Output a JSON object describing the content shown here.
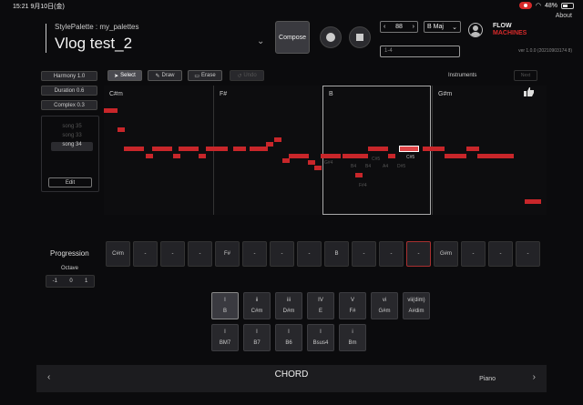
{
  "status_bar": {
    "time": "15:21",
    "date": "9月10日(金)",
    "battery": "48%"
  },
  "header": {
    "palette_label": "StylePalette : my_palettes",
    "song_title": "Vlog test_2",
    "compose_label": "Compose",
    "tempo": "88",
    "key": "B Maj",
    "range": "1-4",
    "logo_line1": "FLOW",
    "logo_line2": "MACHINES",
    "about": "About",
    "version": "ver 1.0.0 (20210903174 8)"
  },
  "params": {
    "harmony": "Harmony 1.0",
    "duration": "Duration 0.6",
    "complex": "Complex 0.3"
  },
  "songs": [
    "song 35",
    "song 33",
    "song 34"
  ],
  "edit_label": "Edit",
  "toolbar": {
    "select": "Select",
    "draw": "Draw",
    "erase": "Erase",
    "undo": "Undo",
    "instruments": "Instruments",
    "next": "Next"
  },
  "piano_roll": {
    "sections": [
      "C#m",
      "F#",
      "B",
      "G#m"
    ],
    "ghost_notes": [
      "C#5",
      "G#4",
      "B4",
      "B4",
      "A4",
      "D#5",
      "F#4",
      "C#5"
    ],
    "selected_note_label": "C#5"
  },
  "progression": {
    "label": "Progression",
    "octave_label": "Octave",
    "octave_values": [
      "-1",
      "0",
      "1"
    ],
    "cells": [
      "C#m",
      "-",
      "-",
      "-",
      "F#",
      "-",
      "-",
      "-",
      "B",
      "-",
      "-",
      "-",
      "G#m",
      "-",
      "-",
      "-"
    ]
  },
  "chords": {
    "row1": [
      {
        "deg": "I",
        "name": "B"
      },
      {
        "deg": "ii",
        "name": "C#m"
      },
      {
        "deg": "iii",
        "name": "D#m"
      },
      {
        "deg": "IV",
        "name": "E"
      },
      {
        "deg": "V",
        "name": "F#"
      },
      {
        "deg": "vi",
        "name": "G#m"
      },
      {
        "deg": "vii(dim)",
        "name": "A#dim"
      }
    ],
    "row2": [
      {
        "deg": "I",
        "name": "BM7"
      },
      {
        "deg": "I",
        "name": "B7"
      },
      {
        "deg": "I",
        "name": "B6"
      },
      {
        "deg": "I",
        "name": "Bsus4"
      },
      {
        "deg": "i",
        "name": "Bm"
      }
    ]
  },
  "bottom_bar": {
    "title": "CHORD",
    "instrument": "Piano",
    "prev": "‹",
    "next": "›"
  },
  "colors": {
    "note": "#c8262a",
    "background": "#0b0b0d"
  }
}
